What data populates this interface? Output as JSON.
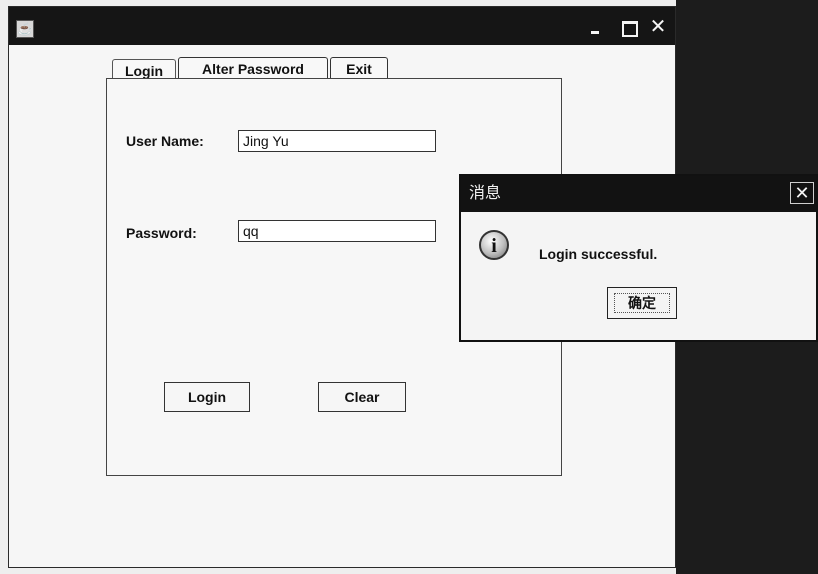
{
  "window": {
    "minimize_icon": "minimize-icon",
    "maximize_icon": "maximize-icon",
    "close_icon": "close-icon"
  },
  "tabs": [
    {
      "label": "Login"
    },
    {
      "label": "Alter Password"
    },
    {
      "label": "Exit"
    }
  ],
  "form": {
    "username_label": "User Name:",
    "username_value": "Jing Yu",
    "password_label": "Password:",
    "password_value": "qq",
    "login_button": "Login",
    "clear_button": "Clear"
  },
  "dialog": {
    "title": "消息",
    "message": "Login successful.",
    "ok_button": "确定",
    "icon": "info-icon"
  },
  "colors": {
    "titlebar": "#151515",
    "window_bg": "#f4f4f4",
    "desktop": "#1c1c1c"
  }
}
